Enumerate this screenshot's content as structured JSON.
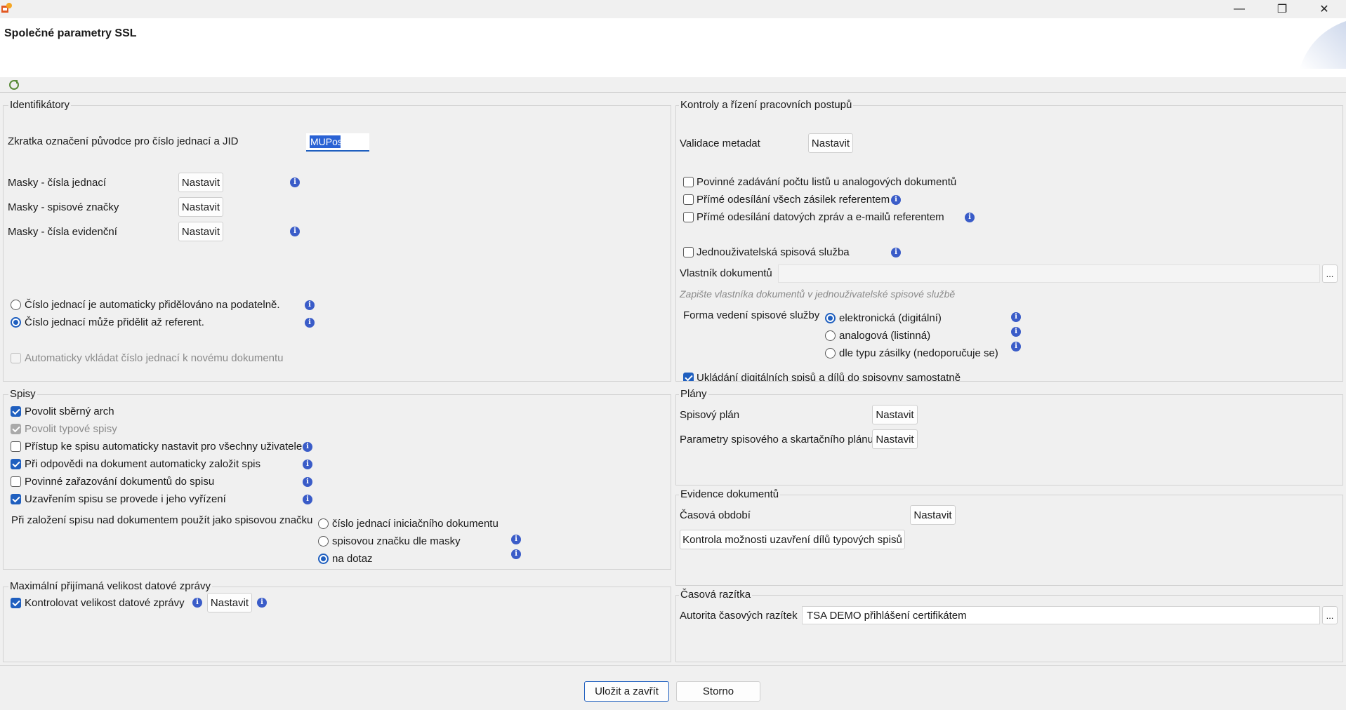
{
  "window": {
    "title": "Společné parametry SSL",
    "minimize_glyph": "—",
    "restore_glyph": "❐",
    "close_glyph": "✕"
  },
  "identifikatory": {
    "title": "Identifikátory",
    "zkratka_label": "Zkratka označení původce pro číslo jednací a JID",
    "zkratka_value": "MUPos",
    "masky_cisla_jednaci": "Masky - čísla jednací",
    "masky_spisove_znacky": "Masky - spisové značky",
    "masky_cisla_evidencni": "Masky - čísla evidenční",
    "radio_auto": "Číslo jednací je automaticky přidělováno na podatelně.",
    "radio_referent": "Číslo jednací může přidělit až referent.",
    "auto_vkladat": "Automaticky vkládat číslo jednací k novému dokumentu"
  },
  "common": {
    "nastavit": "Nastavit",
    "info_glyph": "i",
    "ellipsis": "..."
  },
  "kontroly": {
    "title": "Kontroly a řízení pracovních postupů",
    "validace_label": "Validace metadat",
    "povinne_zadavani": "Povinné zadávání počtu listů u analogových dokumentů",
    "prime_odesilani_zasilek": "Přímé odesílání všech zásilek referentem",
    "prime_odesilani_zprav": "Přímé odesílání datových zpráv a e-mailů referentem",
    "jednouzivatelska": "Jednouživatelská spisová služba",
    "vlastnik_label": "Vlastník dokumentů",
    "vlastnik_value": "",
    "vlastnik_hint": "Zapište vlastníka dokumentů v jednouživatelské spisové službě",
    "forma_label": "Forma vedení spisové služby",
    "forma_options": [
      "elektronická (digitální)",
      "analogová (listinná)",
      "dle typu zásilky (nedoporučuje se)"
    ],
    "forma_selected": 0,
    "ukladani": "Ukládání digitálních spisů a dílů do spisovny samostatně"
  },
  "spisy": {
    "title": "Spisy",
    "povolit_sberny": "Povolit sběrný arch",
    "povolit_typove": "Povolit typové spisy",
    "pristup": "Přístup ke spisu automaticky nastavit pro všechny uživatele",
    "pri_odpovedi": "Při odpovědi na dokument automaticky založit spis",
    "povinne_zarazovani": "Povinné zařazování dokumentů do spisu",
    "uzavrenim": "Uzavřením spisu se provede i jeho vyřízení",
    "pri_zalozeni_label": "Při založení spisu nad dokumentem použít jako spisovou značku",
    "znacka_options": [
      "číslo jednací iniciačního dokumentu",
      "spisovou značku dle masky",
      "na dotaz"
    ],
    "znacka_selected": 2
  },
  "plany": {
    "title": "Plány",
    "spisovy_plan": "Spisový plán",
    "parametry": "Parametry spisového a skartačního plánu"
  },
  "evidence": {
    "title": "Evidence dokumentů",
    "casova_obdobi": "Časová období",
    "kontrola_btn": "Kontrola možnosti uzavření dílů typových spisů"
  },
  "maximalni": {
    "title": "Maximální přijímaná velikost datové zprávy",
    "kontrolovat": "Kontrolovat velikost datové zprávy"
  },
  "razitka": {
    "title": "Časová razítka",
    "autorita_label": "Autorita časových razítek",
    "autorita_value": "TSA DEMO přihlášení certifikátem"
  },
  "footer": {
    "save": "Uložit a zavřít",
    "cancel": "Storno"
  },
  "colors": {
    "accent": "#1f5fbf",
    "info": "#3a5cc8"
  }
}
